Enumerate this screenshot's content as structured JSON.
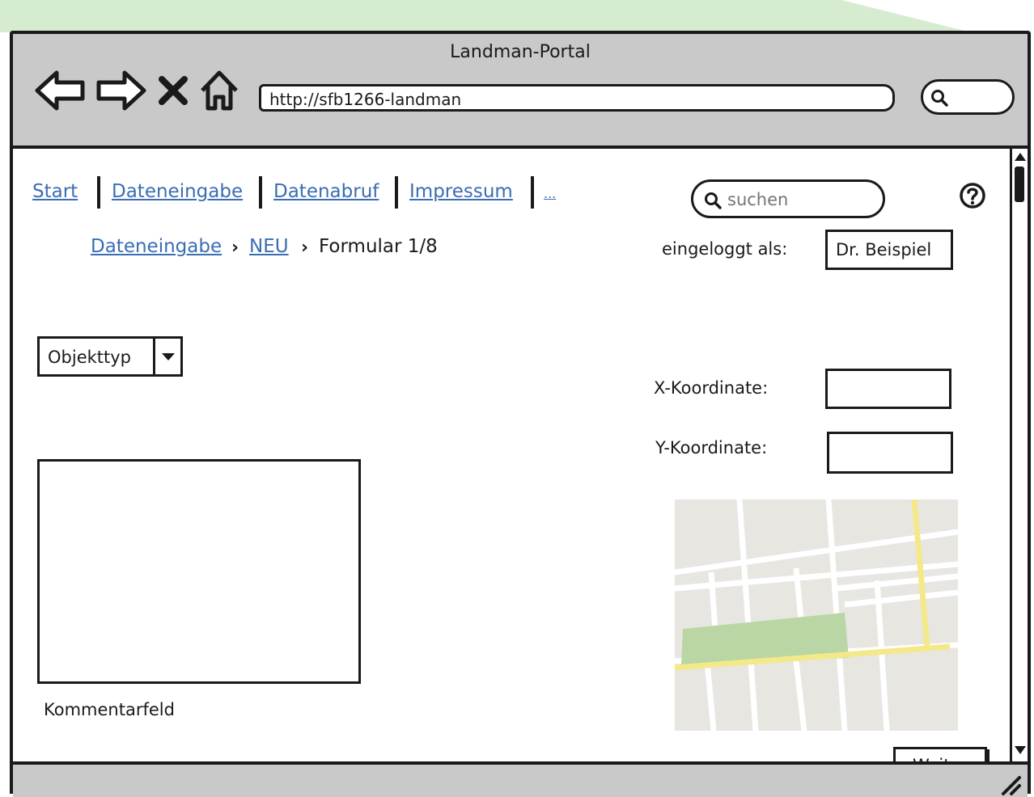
{
  "window": {
    "title": "Landman-Portal",
    "url": "http://sfb1266-landman"
  },
  "nav": {
    "links": [
      "Start",
      "Dateneingabe",
      "Datenabruf",
      "Impressum",
      "..."
    ]
  },
  "search": {
    "placeholder": "suchen"
  },
  "help": {
    "icon": "help-icon"
  },
  "breadcrumb": {
    "items": [
      "Dateneingabe",
      "NEU",
      "Formular 1/8"
    ]
  },
  "user": {
    "label": "eingeloggt als:",
    "name": "Dr. Beispiel"
  },
  "form": {
    "object_type": "Objekttyp",
    "x_label": "X-Koordinate:",
    "y_label": "Y-Koordinate:",
    "comment_label": "Kommentarfeld",
    "next_button": "Weiter"
  },
  "colors": {
    "link": "#3b6db3",
    "chrome": "#c9c9c9",
    "map_bg": "#e8e6e1",
    "map_park": "#b9d6a4",
    "map_road": "#f3e98a"
  }
}
